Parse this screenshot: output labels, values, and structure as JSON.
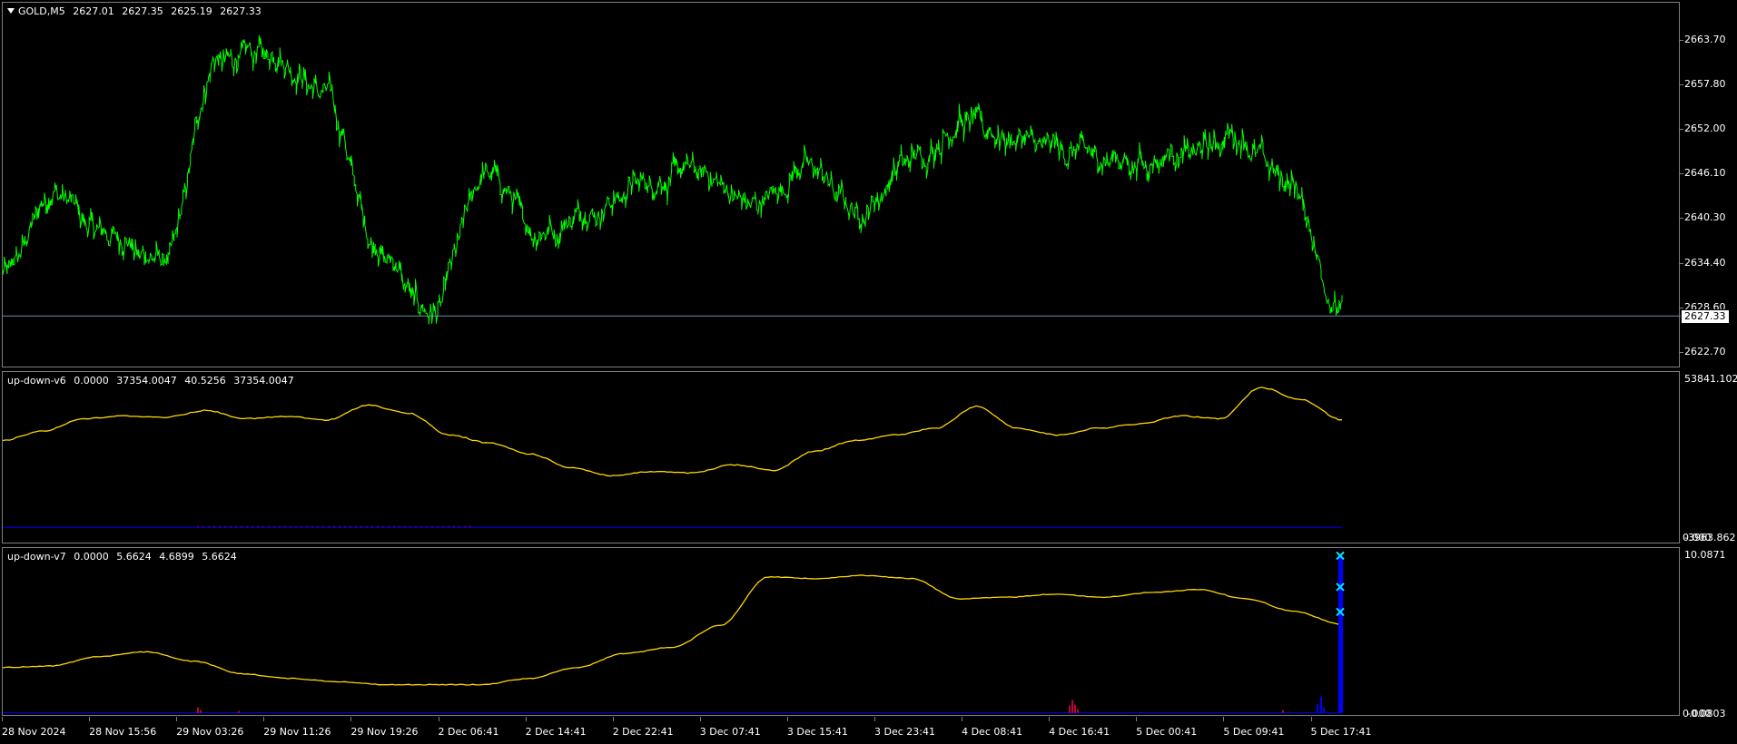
{
  "main": {
    "symbol": "GOLD,M5",
    "ohlc": [
      "2627.01",
      "2627.35",
      "2625.19",
      "2627.33"
    ],
    "y_ticks": [
      "2663.70",
      "2657.80",
      "2652.00",
      "2646.10",
      "2640.30",
      "2634.40",
      "2628.60",
      "2622.70"
    ],
    "current_price": "2627.33",
    "line_color": "#00ff00",
    "price_line_color": "#6e8da6"
  },
  "v6": {
    "name": "up-down-v6",
    "values": [
      "0.0000",
      "37354.0047",
      "40.5256",
      "37354.0047"
    ],
    "y_top": "53841.102",
    "y_bottom_a": "0.000",
    "y_bottom_b": "-3963.862",
    "line_color": "#ffd700"
  },
  "v7": {
    "name": "up-down-v7",
    "values": [
      "0.0000",
      "5.6624",
      "4.6899",
      "5.6624"
    ],
    "y_top": "10.0871",
    "y_bottom_a": "0.000",
    "y_bottom_b": "-0.0803",
    "line_color": "#ffd700",
    "marker_color": "#00e5ff",
    "bar_color": "#0000ff"
  },
  "x_labels": [
    "28 Nov 2024",
    "28 Nov 15:56",
    "29 Nov 03:26",
    "29 Nov 11:26",
    "29 Nov 19:26",
    "2 Dec 06:41",
    "2 Dec 14:41",
    "2 Dec 22:41",
    "3 Dec 07:41",
    "3 Dec 15:41",
    "3 Dec 23:41",
    "4 Dec 08:41",
    "4 Dec 16:41",
    "5 Dec 00:41",
    "5 Dec 09:41",
    "5 Dec 17:41"
  ],
  "chart_data": [
    {
      "type": "line",
      "title": "GOLD,M5",
      "y_ticks": [
        2663.7,
        2657.8,
        2652.0,
        2646.1,
        2640.3,
        2634.4,
        2628.6,
        2622.7
      ],
      "ylim": [
        2621.0,
        2668.0
      ],
      "x": [
        "28 Nov 2024",
        "28 Nov 15:56",
        "29 Nov 03:26",
        "29 Nov 11:26",
        "29 Nov 19:26",
        "2 Dec 06:41",
        "2 Dec 14:41",
        "2 Dec 22:41",
        "3 Dec 07:41",
        "3 Dec 15:41",
        "3 Dec 23:41",
        "4 Dec 08:41",
        "4 Dec 16:41",
        "5 Dec 00:41",
        "5 Dec 09:41",
        "5 Dec 17:41"
      ],
      "series": [
        {
          "name": "GOLD,M5",
          "values": [
            2633.0,
            2643.5,
            2638.0,
            2634.5,
            2661.0,
            2662.0,
            2657.0,
            2636.0,
            2627.5,
            2646.0,
            2638.5,
            2641.0,
            2645.0,
            2646.5,
            2642.0,
            2647.0,
            2641.0,
            2648.0,
            2653.0,
            2650.0,
            2649.0,
            2647.5,
            2648.5,
            2651.0,
            2645.0,
            2628.0
          ]
        }
      ],
      "current": 2627.33
    },
    {
      "type": "line",
      "title": "up-down-v6",
      "y_ticks": [
        53841.102,
        0.0,
        -3963.862
      ],
      "ylim": [
        -3963.862,
        53841.102
      ],
      "series": [
        {
          "name": "up-down-v6",
          "values": [
            32000,
            35500,
            40000,
            41000,
            40500,
            43000,
            40000,
            40800,
            39500,
            45000,
            42000,
            34000,
            31000,
            27000,
            22000,
            19000,
            20500,
            20000,
            23000,
            21000,
            28000,
            32000,
            34000,
            36500,
            44500,
            36500,
            34000,
            36500,
            38000,
            41000,
            40000,
            51500,
            47000,
            39500
          ]
        }
      ]
    },
    {
      "type": "line",
      "title": "up-down-v7",
      "y_ticks": [
        10.0871,
        0.0,
        -0.0803
      ],
      "ylim": [
        -0.0803,
        10.0871
      ],
      "series": [
        {
          "name": "up-down-v7",
          "values": [
            2.9,
            3.0,
            3.6,
            3.9,
            3.3,
            2.5,
            2.2,
            2.0,
            1.8,
            1.8,
            1.8,
            2.2,
            2.9,
            3.8,
            4.2,
            5.6,
            8.7,
            8.6,
            8.8,
            8.6,
            7.3,
            7.4,
            7.6,
            7.4,
            7.7,
            7.9,
            7.3,
            6.5,
            5.66
          ]
        }
      ]
    }
  ]
}
